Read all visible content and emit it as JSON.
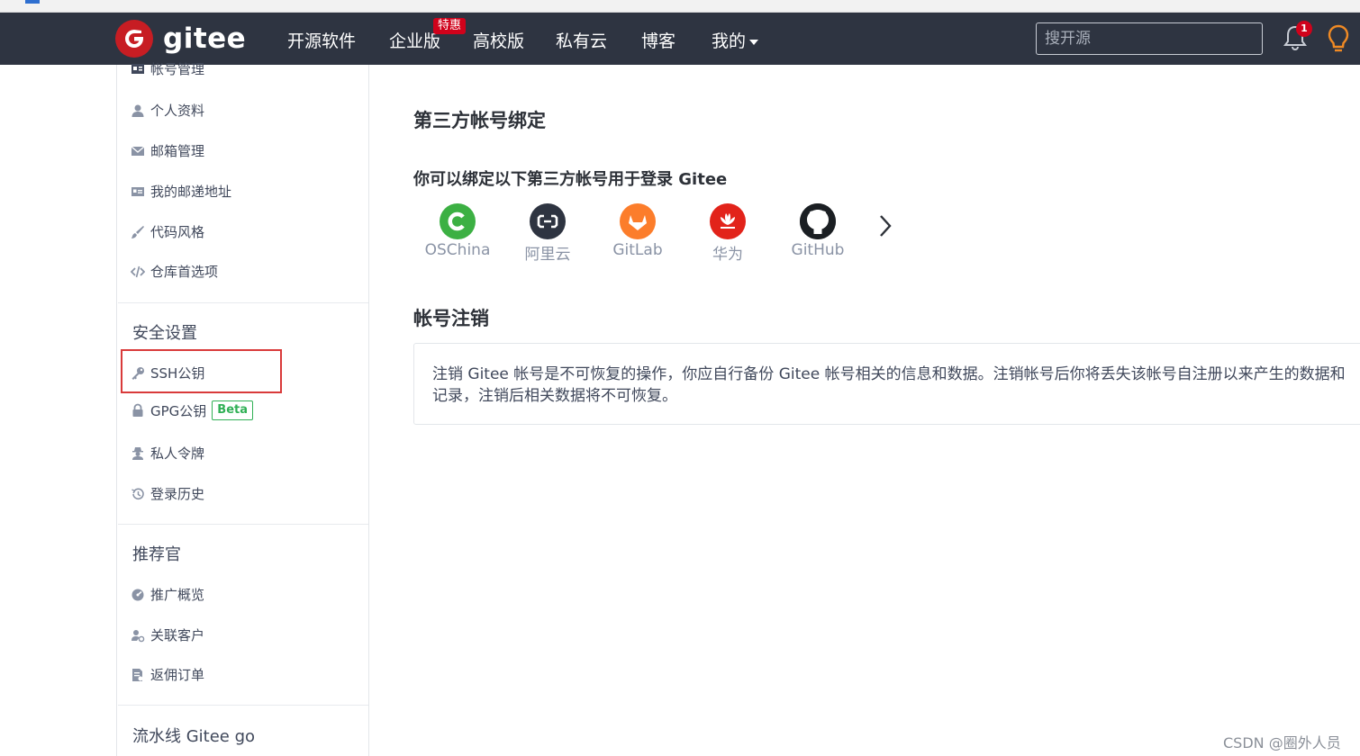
{
  "brand": {
    "name": "gitee"
  },
  "nav": {
    "items": [
      "开源软件",
      "企业版",
      "高校版",
      "私有云",
      "博客"
    ],
    "enterprise_badge": "特惠",
    "mine_label": "我的",
    "search_placeholder": "搜开源",
    "notification_count": "1"
  },
  "sidebar": {
    "account_header": "帐号管理",
    "account_items": [
      "个人资料",
      "邮箱管理",
      "我的邮递地址",
      "代码风格",
      "仓库首选项"
    ],
    "security_header": "安全设置",
    "security_items": [
      "SSH公钥",
      "GPG公钥",
      "私人令牌",
      "登录历史"
    ],
    "beta_badge": "Beta",
    "referral_header": "推荐官",
    "referral_items": [
      "推广概览",
      "关联客户",
      "返佣订单"
    ],
    "pipeline_header": "流水线 Gitee go"
  },
  "main": {
    "third_party_title": "第三方帐号绑定",
    "third_party_subtitle": "你可以绑定以下第三方帐号用于登录 Gitee",
    "providers": [
      {
        "name": "OSChina",
        "color": "#3cb043"
      },
      {
        "name": "阿里云",
        "color": "#2e3441"
      },
      {
        "name": "GitLab",
        "color": "#fc7d2b"
      },
      {
        "name": "华为",
        "color": "#e2231a"
      },
      {
        "name": "GitHub",
        "color": "#1b1f23"
      }
    ],
    "cancel_title": "帐号注销",
    "cancel_text": "注销 Gitee 帐号是不可恢复的操作，你应自行备份 Gitee 帐号相关的信息和数据。注销帐号后你将丢失该帐号自注册以来产生的数据和记录，注销后相关数据将不可恢复。"
  },
  "watermark": "CSDN @圈外人员"
}
